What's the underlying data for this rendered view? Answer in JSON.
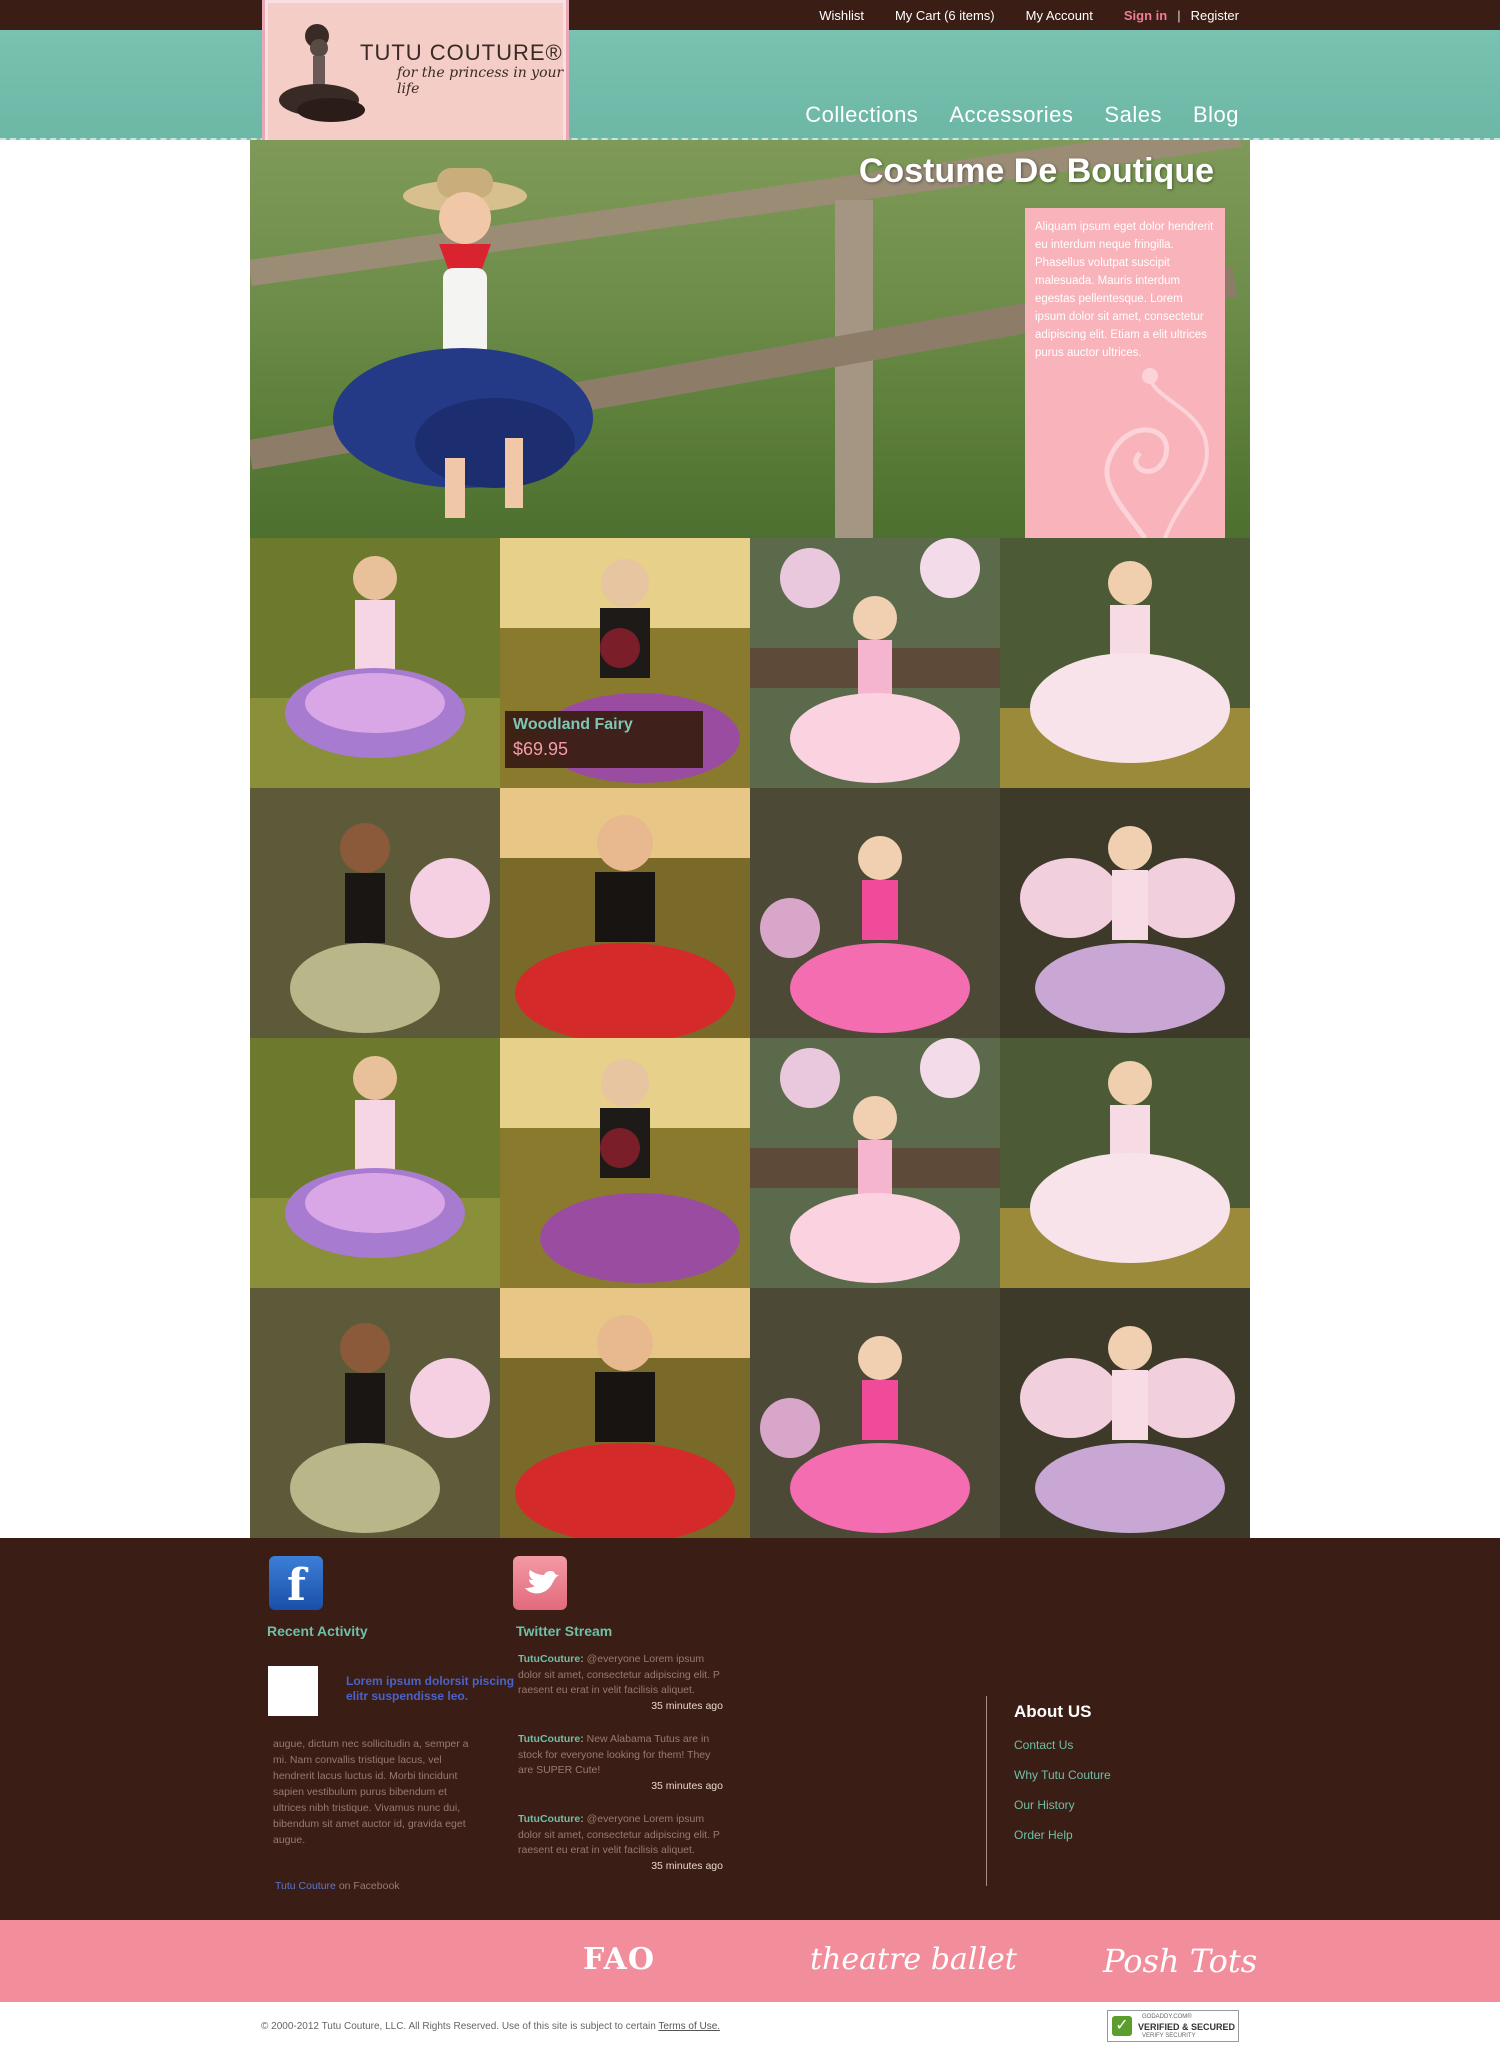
{
  "topbar": {
    "wishlist": "Wishlist",
    "cart": "My Cart (6 items)",
    "account": "My Account",
    "signin": "Sign in",
    "separator": "|",
    "register": "Register"
  },
  "logo": {
    "brand": "TUTU COUTURE®",
    "tagline": "for the princess in your life"
  },
  "nav": [
    "Collections",
    "Accessories",
    "Sales",
    "Blog"
  ],
  "hero": {
    "title": "Costume De Boutique",
    "text": "Aliquam ipsum eget dolor hendrerit eu interdum neque fringilla. Phasellus volutpat suscipit malesuada. Mauris interdum egestas pellentesque. Lorem ipsum dolor sit amet, consectetur adipiscing elit. Etiam a elit ultrices purus auctor ultrices."
  },
  "product_overlay": {
    "name": "Woodland Fairy",
    "price": "$69.95"
  },
  "colors": {
    "brown": "#3a1d14",
    "teal": "#79c2b1",
    "pink": "#f28e9c",
    "panel_pink": "#f9b3bb"
  },
  "footer": {
    "facebook": {
      "icon": "facebook-icon",
      "title": "Recent Activity",
      "post_title": "Lorem ipsum dolorsit piscing elitr suspendisse leo.",
      "post_body": "augue, dictum nec sollicitudin a, semper a mi. Nam convallis tristique lacus, vel hendrerit lacus luctus id. Morbi tincidunt sapien vestibulum purus bibendum et ultrices nibh tristique. Vivamus nunc dui, bibendum sit amet auctor id, gravida eget augue.",
      "link_name": "Tutu Couture",
      "link_suffix": " on Facebook"
    },
    "twitter": {
      "icon": "twitter-bird-icon",
      "title": "Twitter Stream",
      "tweets": [
        {
          "handle": "TutuCouture:",
          "text": " @everyone Lorem ipsum dolor sit amet, consectetur adipiscing elit. P raesent eu erat in velit facilisis aliquet.",
          "time": "35 minutes ago"
        },
        {
          "handle": "TutuCouture:",
          "text": " New Alabama Tutus are in stock for everyone looking for them! They are SUPER Cute!",
          "time": "35 minutes ago"
        },
        {
          "handle": "TutuCouture:",
          "text": " @everyone Lorem ipsum dolor sit amet, consectetur adipiscing elit. P raesent eu erat in velit facilisis aliquet.",
          "time": "35 minutes ago"
        }
      ]
    },
    "about": {
      "title": "About US",
      "links": [
        "Contact Us",
        "Why Tutu Couture",
        "Our History",
        "Order Help"
      ]
    }
  },
  "partners": [
    "FAO",
    "theatre ballet",
    "Posh Tots"
  ],
  "copyright": {
    "text": "© 2000-2012 Tutu Couture, LLC.  All Rights Reserved. Use of this site is subject to certain ",
    "terms": "Terms of Use."
  },
  "seal": {
    "line1": "GODADDY.COM®",
    "line2": "VERIFIED & SECURED",
    "line3": "VERIFY SECURITY"
  }
}
